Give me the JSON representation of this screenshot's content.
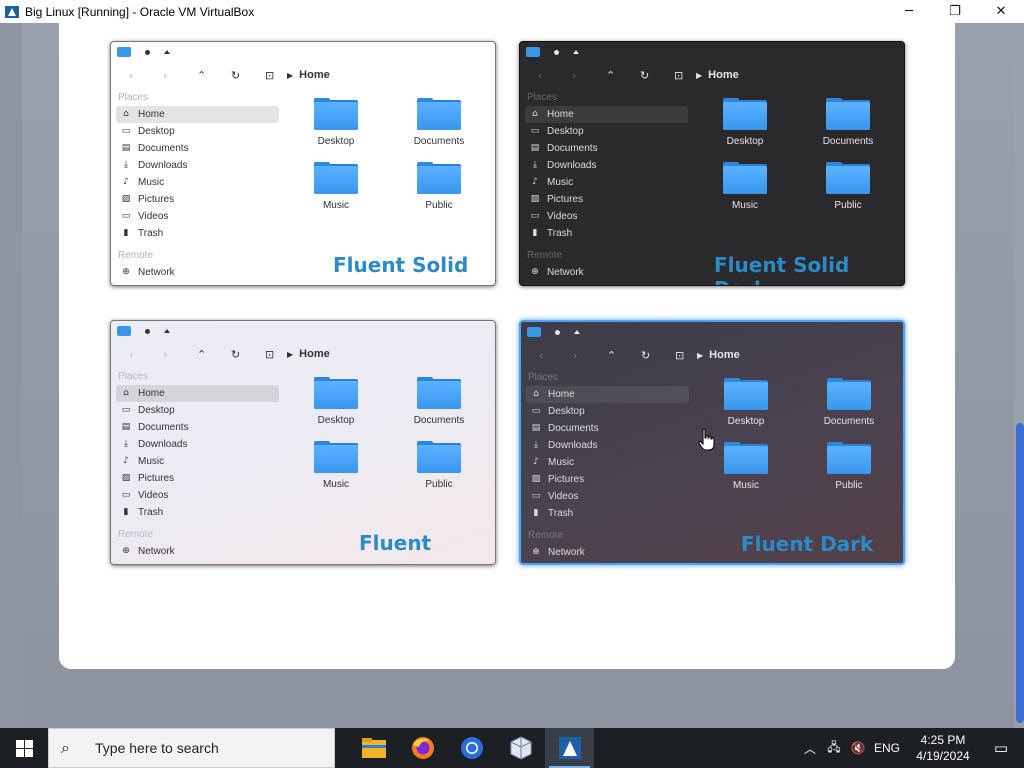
{
  "window": {
    "title": "Big Linux [Running] - Oracle VM VirtualBox",
    "minimize": "─",
    "restore": "❐",
    "close": "✕"
  },
  "previews": [
    {
      "id": "fluent-solid",
      "theme_label": "Fluent Solid",
      "breadcrumb": "Home",
      "places_label": "Places",
      "remote_label": "Remote",
      "places": [
        {
          "label": "Home",
          "icon": "home-icon"
        },
        {
          "label": "Desktop",
          "icon": "desktop-icon"
        },
        {
          "label": "Documents",
          "icon": "documents-icon"
        },
        {
          "label": "Downloads",
          "icon": "downloads-icon"
        },
        {
          "label": "Music",
          "icon": "music-icon"
        },
        {
          "label": "Pictures",
          "icon": "pictures-icon"
        },
        {
          "label": "Videos",
          "icon": "videos-icon"
        },
        {
          "label": "Trash",
          "icon": "trash-icon"
        }
      ],
      "network_label": "Network",
      "folders": [
        "Desktop",
        "Documents",
        "Music",
        "Public"
      ]
    },
    {
      "id": "fluent-solid-dark",
      "theme_label": "Fluent Solid Dark",
      "breadcrumb": "Home",
      "places_label": "Places",
      "remote_label": "Remote",
      "places": [
        {
          "label": "Home",
          "icon": "home-icon"
        },
        {
          "label": "Desktop",
          "icon": "desktop-icon"
        },
        {
          "label": "Documents",
          "icon": "documents-icon"
        },
        {
          "label": "Downloads",
          "icon": "downloads-icon"
        },
        {
          "label": "Music",
          "icon": "music-icon"
        },
        {
          "label": "Pictures",
          "icon": "pictures-icon"
        },
        {
          "label": "Videos",
          "icon": "videos-icon"
        },
        {
          "label": "Trash",
          "icon": "trash-icon"
        }
      ],
      "network_label": "Network",
      "folders": [
        "Desktop",
        "Documents",
        "Music",
        "Public"
      ]
    },
    {
      "id": "fluent",
      "theme_label": "Fluent",
      "breadcrumb": "Home",
      "places_label": "Places",
      "remote_label": "Remote",
      "places": [
        {
          "label": "Home",
          "icon": "home-icon"
        },
        {
          "label": "Desktop",
          "icon": "desktop-icon"
        },
        {
          "label": "Documents",
          "icon": "documents-icon"
        },
        {
          "label": "Downloads",
          "icon": "downloads-icon"
        },
        {
          "label": "Music",
          "icon": "music-icon"
        },
        {
          "label": "Pictures",
          "icon": "pictures-icon"
        },
        {
          "label": "Videos",
          "icon": "videos-icon"
        },
        {
          "label": "Trash",
          "icon": "trash-icon"
        }
      ],
      "network_label": "Network",
      "folders": [
        "Desktop",
        "Documents",
        "Music",
        "Public"
      ]
    },
    {
      "id": "fluent-dark",
      "theme_label": "Fluent Dark",
      "breadcrumb": "Home",
      "places_label": "Places",
      "remote_label": "Remote",
      "places": [
        {
          "label": "Home",
          "icon": "home-icon"
        },
        {
          "label": "Desktop",
          "icon": "desktop-icon"
        },
        {
          "label": "Documents",
          "icon": "documents-icon"
        },
        {
          "label": "Downloads",
          "icon": "downloads-icon"
        },
        {
          "label": "Music",
          "icon": "music-icon"
        },
        {
          "label": "Pictures",
          "icon": "pictures-icon"
        },
        {
          "label": "Videos",
          "icon": "videos-icon"
        },
        {
          "label": "Trash",
          "icon": "trash-icon"
        }
      ],
      "network_label": "Network",
      "folders": [
        "Desktop",
        "Documents",
        "Music",
        "Public"
      ]
    }
  ],
  "colors": {
    "accent": "#4da3ff",
    "theme_title": "#2b8ac8",
    "folder": "#3996ee",
    "taskbar": "#1c1f24"
  },
  "taskbar": {
    "search_placeholder": "Type here to search",
    "apps": [
      {
        "name": "File Explorer",
        "icon": "file-explorer-icon"
      },
      {
        "name": "Firefox",
        "icon": "firefox-icon"
      },
      {
        "name": "Chrome",
        "icon": "chrome-icon"
      },
      {
        "name": "VirtualBox",
        "icon": "virtualbox-icon"
      },
      {
        "name": "Big Linux VM",
        "icon": "vm-window-icon"
      }
    ],
    "tray": {
      "language": "ENG",
      "time": "4:25 PM",
      "date": "4/19/2024"
    }
  }
}
